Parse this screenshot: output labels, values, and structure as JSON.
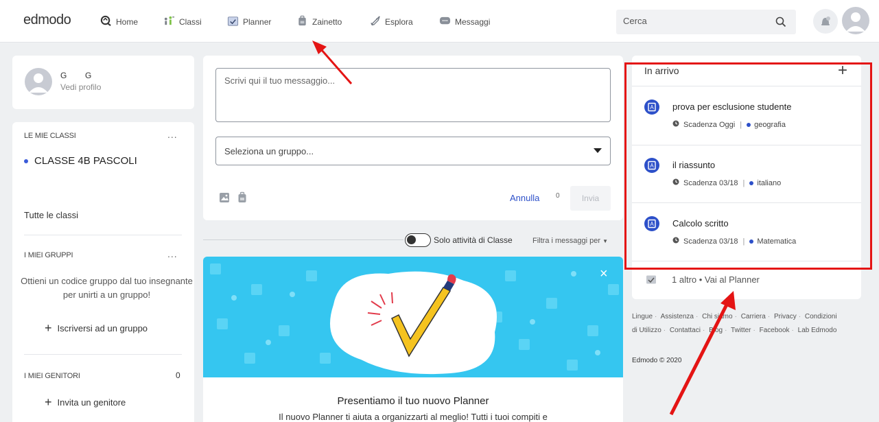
{
  "topbar": {
    "logo": "edmodo",
    "nav": [
      {
        "label": "Home",
        "icon": "home-icon"
      },
      {
        "label": "Classi",
        "icon": "classes-icon"
      },
      {
        "label": "Planner",
        "icon": "planner-icon"
      },
      {
        "label": "Zainetto",
        "icon": "backpack-icon"
      },
      {
        "label": "Esplora",
        "icon": "rocket-icon"
      },
      {
        "label": "Messaggi",
        "icon": "chat-icon"
      }
    ],
    "search_placeholder": "Cerca"
  },
  "profile": {
    "name": "G        G",
    "link": "Vedi profilo"
  },
  "classes": {
    "title": "LE MIE CLASSI",
    "menu": "...",
    "items": [
      "CLASSE 4B PASCOLI"
    ],
    "all_label": "Tutte le classi"
  },
  "groups": {
    "title": "I MIEI GRUPPI",
    "menu": "...",
    "text": "Ottieni un codice gruppo dal tuo insegnante per unirti a un gruppo!",
    "join": "Iscriversi ad un gruppo"
  },
  "parents": {
    "title": "I MIEI GENITORI",
    "count": "0",
    "invite": "Invita un genitore"
  },
  "composer": {
    "placeholder": "Scrivi qui il tuo messaggio...",
    "group_select": "Seleziona un gruppo...",
    "cancel": "Annulla",
    "char_count": "0",
    "send": "Invia"
  },
  "feed": {
    "toggle_label": "Solo attività di Classe",
    "filter": "Filtra i messaggi per"
  },
  "planner_promo": {
    "title": "Presentiamo il tuo nuovo Planner",
    "desc": "Il nuovo Planner ti aiuta a organizzarti al meglio! Tutti i tuoi compiti e"
  },
  "due": {
    "title": "In arrivo",
    "items": [
      {
        "name": "prova per esclusione studente",
        "due": "Scadenza Oggi",
        "subject": "geografia"
      },
      {
        "name": "il riassunto",
        "due": "Scadenza 03/18",
        "subject": "italiano"
      },
      {
        "name": "Calcolo scritto",
        "due": "Scadenza 03/18",
        "subject": "Matematica"
      }
    ],
    "more": "1 altro • Vai al Planner"
  },
  "footer": {
    "links": [
      "Lingue",
      "Assistenza",
      "Chi siamo",
      "Carriera",
      "Privacy",
      "Condizioni di Utilizzo",
      "Contattaci",
      "Blog",
      "Twitter",
      "Facebook",
      "Lab Edmodo"
    ],
    "copyright": "Edmodo © 2020"
  },
  "colors": {
    "accent": "#2d50c9",
    "banner": "#35c6f0",
    "annotation": "#e41414"
  }
}
